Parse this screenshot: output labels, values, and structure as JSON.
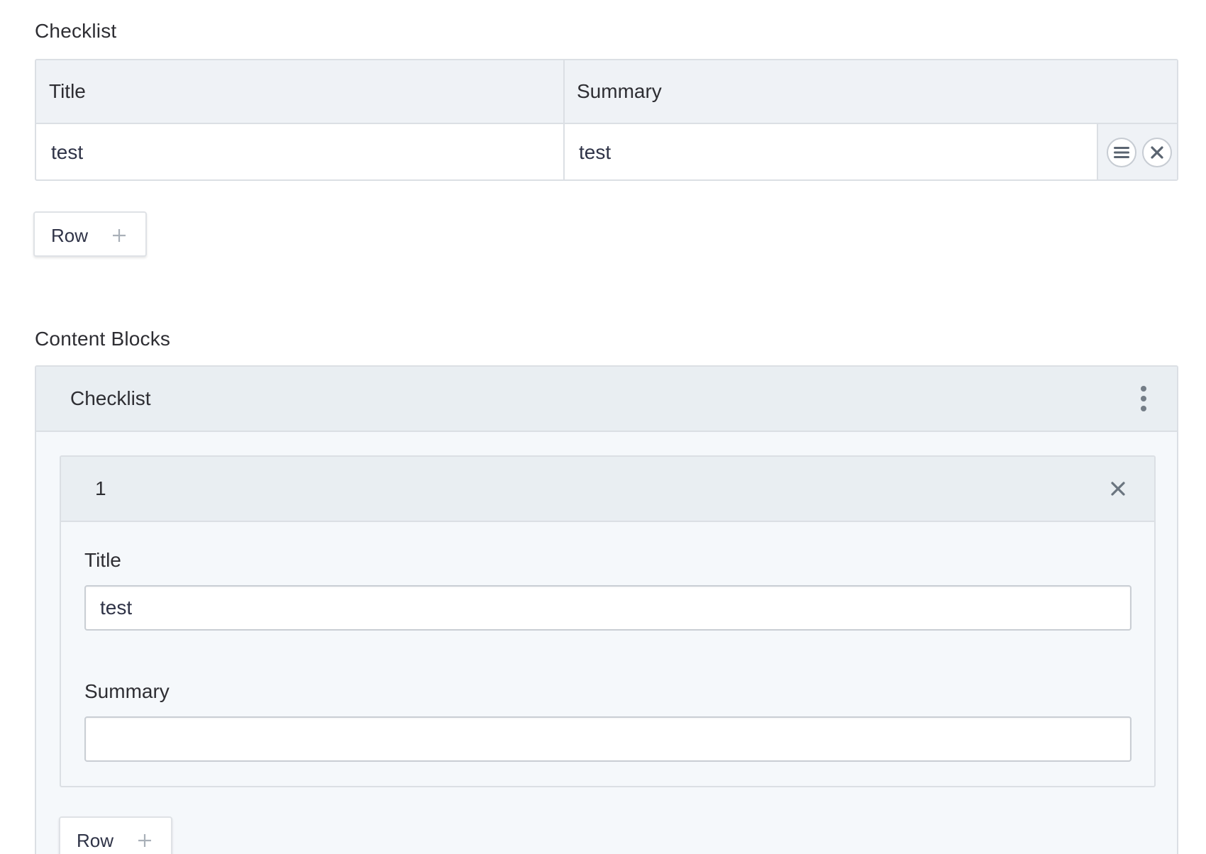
{
  "checklist_section": {
    "label": "Checklist",
    "columns": [
      "Title",
      "Summary"
    ],
    "rows": [
      {
        "title": "test",
        "summary": "test"
      }
    ],
    "row_actions": {
      "menu_icon": "menu-icon",
      "remove_icon": "close-icon"
    },
    "add_row_label": "Row"
  },
  "content_blocks_section": {
    "label": "Content Blocks",
    "block": {
      "title": "Checklist",
      "menu_icon": "more-vertical-icon",
      "item": {
        "number": "1",
        "close_icon": "close-icon",
        "fields": {
          "title_label": "Title",
          "title_value": "test",
          "summary_label": "Summary",
          "summary_value": ""
        }
      },
      "add_row_label": "Row"
    }
  },
  "colors": {
    "header_bg": "#eff2f6",
    "block_header_bg": "#e9eef2",
    "border": "#dbdfe4",
    "text": "#2e2e33",
    "icon": "#5a6470"
  }
}
